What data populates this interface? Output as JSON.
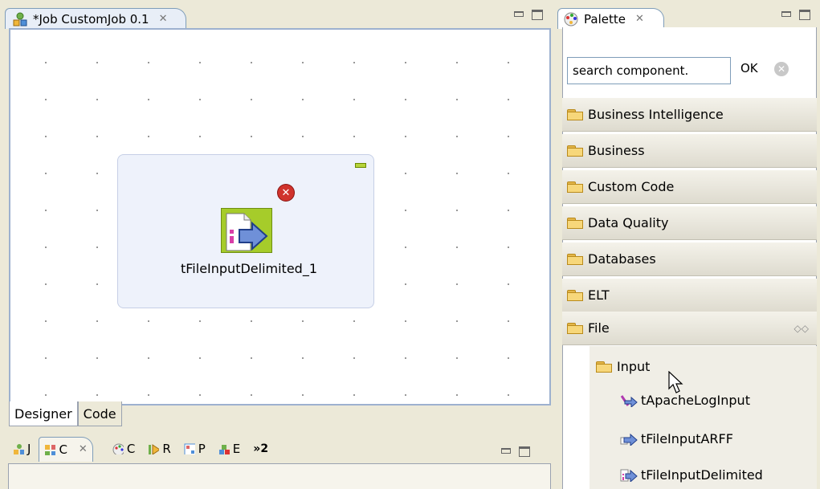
{
  "editor": {
    "tab_title": "*Job CustomJob 0.1",
    "component_label": "tFileInputDelimited_1",
    "bottom_tabs": [
      "Designer",
      "Code"
    ]
  },
  "bottom_views": {
    "tabs": [
      {
        "label": "J",
        "icon": "job-icon"
      },
      {
        "label": "C",
        "icon": "component-icon",
        "active": true
      },
      {
        "label": "C",
        "icon": "palette-icon"
      },
      {
        "label": "R",
        "icon": "run-icon"
      },
      {
        "label": "P",
        "icon": "problems-icon"
      },
      {
        "label": "E",
        "icon": "modules-icon"
      }
    ],
    "overflow_label": "»2"
  },
  "palette": {
    "title": "Palette",
    "search_value": "search component.",
    "ok_label": "OK",
    "categories": [
      "Business Intelligence",
      "Business",
      "Custom Code",
      "Data Quality",
      "Databases",
      "ELT",
      "File"
    ],
    "subfolder": "Input",
    "components": [
      "tApacheLogInput",
      "tFileInputARFF",
      "tFileInputDelimited"
    ]
  }
}
